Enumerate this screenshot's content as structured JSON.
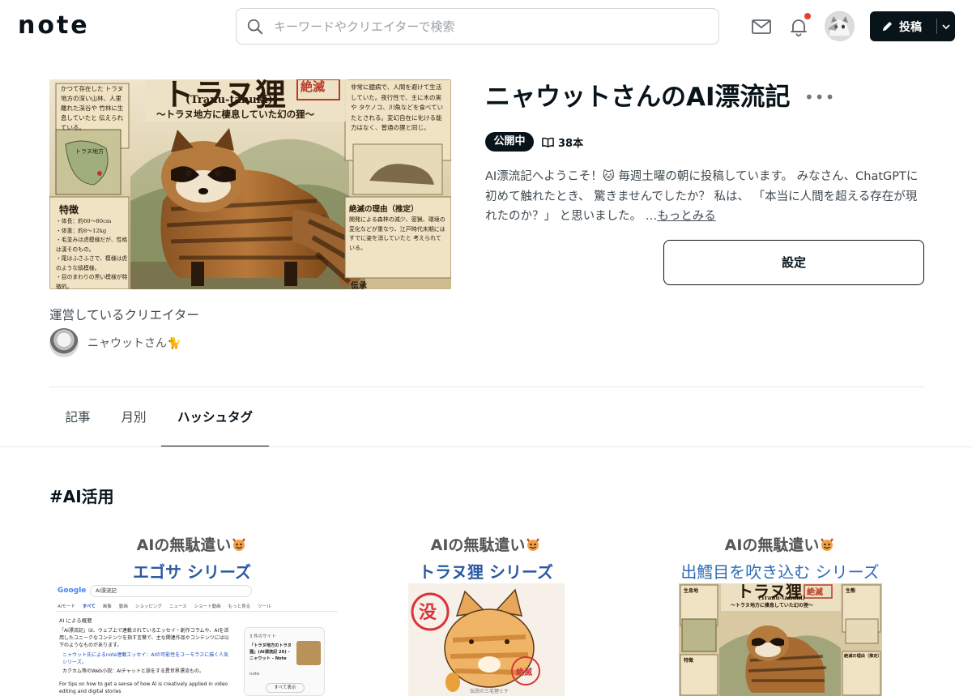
{
  "header": {
    "logo": "note",
    "search_placeholder": "キーワードやクリエイターで検索",
    "post_label": "投稿"
  },
  "magazine": {
    "cover": {
      "title": "トラヌ狸",
      "subtitle_en": "(Tranu-tanuki)",
      "subtitle_jp": "〜トラヌ地方に棲息していた幻の狸〜",
      "stamp": "絶滅",
      "left_note": "かつて存在した トラヌ地方の深い山林、人里離れた渓谷や 竹林に生息していたと 伝えられている。",
      "map_label": "トラヌ地方",
      "features_title": "特徴",
      "features": [
        "・体長：約60〜80cm",
        "・体重：約8〜12kg",
        "・毛並みは虎模様だが、性格は漢そのもの。",
        "・尾はふさふさで、模様は虎のような縞模様。",
        "・目のまわりの黒い模様が特徴的。"
      ],
      "right_note": "非常に臆病で、人間を避けて生活していた。夜行性で、主に木の実や タケノコ、川魚などを食べていたとされる。変幻自在に化ける能力はなく、普通の狸と同じ。",
      "reason_title": "絶滅の理由（推定）",
      "reason_text": "開発による森林の減少、密猟、環境の変化などが重なり、江戸時代末期には すでに姿を消していたと 考えられている。",
      "legend_label": "伝承"
    },
    "title": "ニャウットさんのAI漂流記",
    "status": "公開中",
    "article_count": "38本",
    "description": "AI漂流記へようこそ！🐱 毎週土曜の朝に投稿しています。 みなさん、ChatGPTに初めて触れたとき、 驚きませんでしたか？ 私は、 「本当に人間を超える存在が現れたのか？」 と思いました。 …",
    "more_label": "もっとみる",
    "settings_label": "設定"
  },
  "creator": {
    "section_label": "運営しているクリエイター",
    "name": "ニャウットさん🐈"
  },
  "tabs": [
    {
      "label": "記事",
      "active": false
    },
    {
      "label": "月別",
      "active": false
    },
    {
      "label": "ハッシュタグ",
      "active": true
    }
  ],
  "hashtag_section": {
    "title": "#AI活用",
    "cards": [
      {
        "line1": "AIの無駄遣い",
        "line2": "エゴサ シリーズ",
        "google_logo": "Google",
        "query": "AI漂流記",
        "search_tabs": [
          "AIモード",
          "すべて",
          "画像",
          "動画",
          "ショッピング",
          "ニュース",
          "ショート動画",
          "もっと見る",
          "ツール"
        ],
        "ai_overview": "AI による概要",
        "result_text": "「AI漂流記」は、ウェブ上で連載されているエッセイ・創作コラムや、AIを活用したユニークなコンテンツを指す言葉で、主な関連作品やコンテンツには以下のようなものがあります。",
        "result_bullet": "ニャウット氏によるnote連載エッセイ：AIの可能性をユーモラスに描く人気シリーズ。",
        "result_bullet2": "カクカム等のWeb小説：AIチャットと旅をする異世界漂流もの。",
        "side_title": "「トラヌ地方のトラヌ狸」(AI漂流記 26) - ニャウット - Note",
        "side_label": "3 件のサイト",
        "side_source": "note",
        "show_all": "すべて表示",
        "footer_text": "For tips on how to get a sense of how AI is creatively applied in video editing and digital stories"
      },
      {
        "line1": "AIの無駄遣い",
        "line2": "トラヌ狸 シリーズ",
        "stamp_big": "没",
        "stamp_small": "絶滅",
        "caption": "伝説の三毛狸ミケ"
      },
      {
        "line1": "AIの無駄遣い",
        "line2": "出鱈目を吹き込む シリーズ",
        "mini_title": "トラヌ狸",
        "mini_stamp": "絶滅",
        "mini_sub_en": "(Tranu-tanuki)",
        "mini_sub_jp": "〜トラヌ地方に棲息していた幻の狸〜",
        "mini_left": "生息地",
        "mini_right": "生態",
        "mini_features": "特徴",
        "mini_reason": "絶滅の理由（推定）"
      }
    ]
  },
  "colors": {
    "ink": "#08131a",
    "accent_blue": "#2a5aa0",
    "notif": "#e8402c",
    "parchment": "#e8dcbf"
  }
}
